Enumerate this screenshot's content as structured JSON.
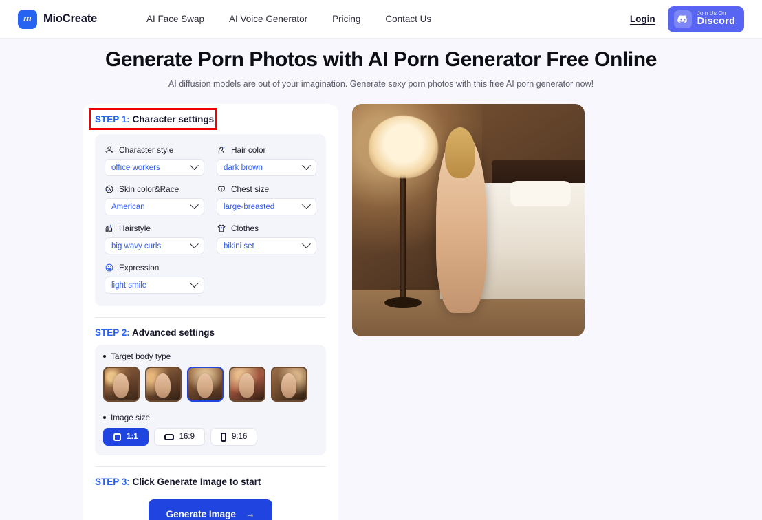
{
  "header": {
    "brand_name": "MioCreate",
    "brand_mark": "m",
    "nav": [
      {
        "label": "AI Face Swap"
      },
      {
        "label": "AI Voice Generator"
      },
      {
        "label": "Pricing"
      },
      {
        "label": "Contact Us"
      }
    ],
    "login_label": "Login",
    "discord": {
      "top_label": "Join Us On",
      "bottom_label": "Discord"
    },
    "accent_color": "#2563f0",
    "discord_color": "#5865f2"
  },
  "hero": {
    "title": "Generate Porn Photos with AI Porn Generator Free Online",
    "subtitle": "AI diffusion models are out of your imagination. Generate sexy porn photos with this free AI porn generator now!"
  },
  "steps": {
    "step1": {
      "num": "STEP 1:",
      "title": " Character settings",
      "highlight_color": "#f20000"
    },
    "step2": {
      "num": "STEP 2:",
      "title": " Advanced settings"
    },
    "step3": {
      "num": "STEP 3:",
      "title": " Click Generate Image to start"
    }
  },
  "character_settings": {
    "fields": [
      {
        "icon": "character-style-icon",
        "label": "Character style",
        "value": "office workers"
      },
      {
        "icon": "hair-color-icon",
        "label": "Hair color",
        "value": "dark brown"
      },
      {
        "icon": "skin-color-icon",
        "label": "Skin color&Race",
        "value": "American"
      },
      {
        "icon": "chest-size-icon",
        "label": "Chest size",
        "value": "large-breasted"
      },
      {
        "icon": "hairstyle-icon",
        "label": "Hairstyle",
        "value": "big wavy curls"
      },
      {
        "icon": "clothes-icon",
        "label": "Clothes",
        "value": "bikini set"
      },
      {
        "icon": "expression-icon",
        "label": "Expression",
        "value": "light smile"
      }
    ],
    "value_color": "#2f5cf0"
  },
  "advanced_settings": {
    "body_type_label": "Target body type",
    "body_types": [
      {
        "name": "body-type-1",
        "selected": false
      },
      {
        "name": "body-type-2",
        "selected": false
      },
      {
        "name": "body-type-3",
        "selected": true
      },
      {
        "name": "body-type-4",
        "selected": false
      },
      {
        "name": "body-type-5",
        "selected": false
      }
    ],
    "image_size_label": "Image size",
    "image_sizes": [
      {
        "label": "1:1",
        "icon": "square-icon",
        "selected": true
      },
      {
        "label": "16:9",
        "icon": "landscape-icon",
        "selected": false
      },
      {
        "label": "9:16",
        "icon": "portrait-icon",
        "selected": false
      }
    ],
    "selected_color": "#1f44e0"
  },
  "generate": {
    "label": "Generate Image",
    "arrow": "→"
  },
  "preview": {
    "alt": "generated-character-preview"
  }
}
